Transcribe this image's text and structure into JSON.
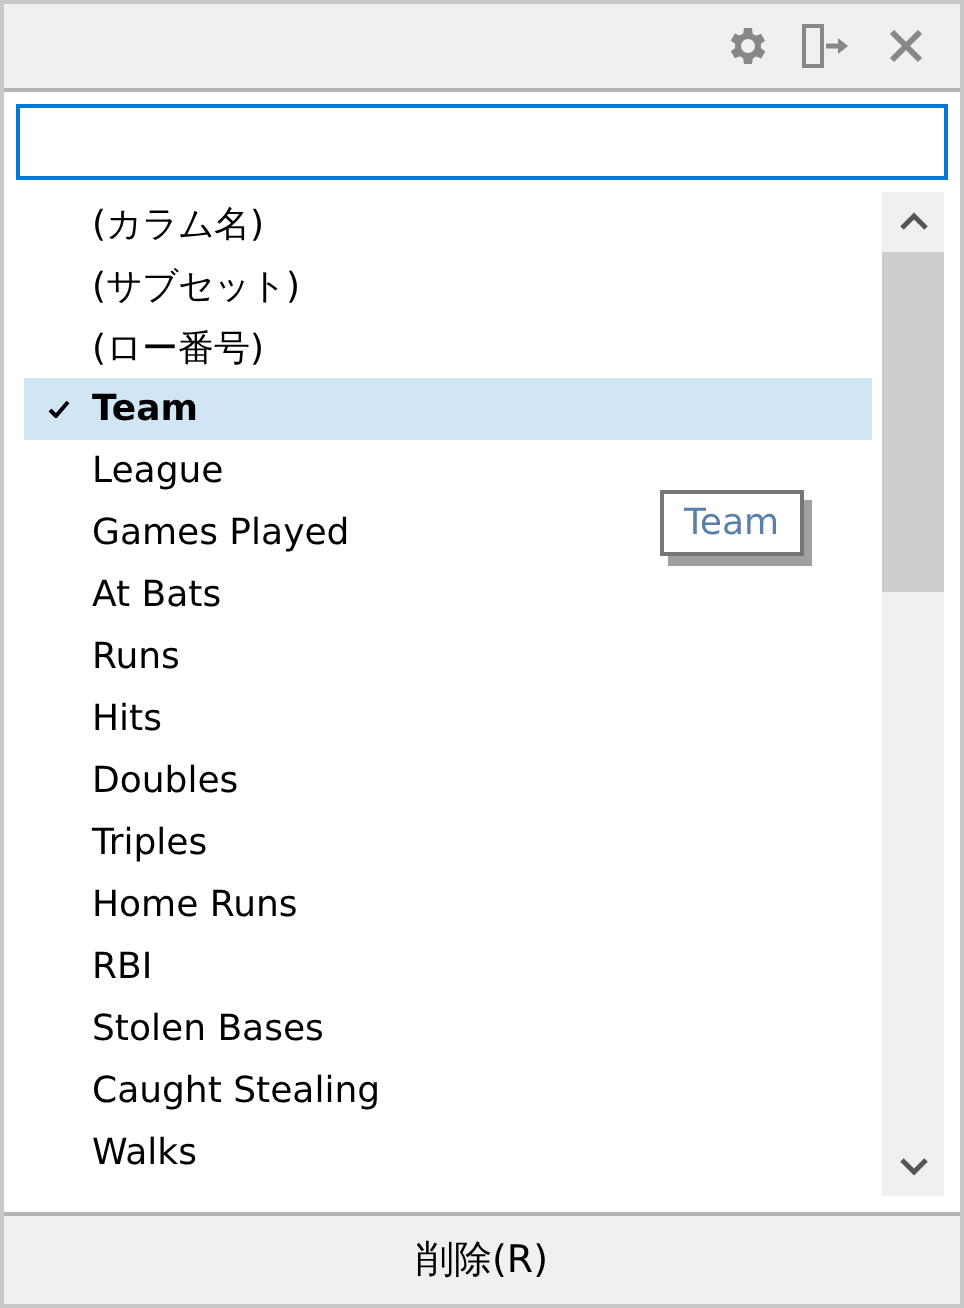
{
  "items": [
    {
      "label": "(カラム名)",
      "selected": false,
      "checked": false
    },
    {
      "label": "(サブセット)",
      "selected": false,
      "checked": false
    },
    {
      "label": "(ロー番号)",
      "selected": false,
      "checked": false
    },
    {
      "label": "Team",
      "selected": true,
      "checked": true
    },
    {
      "label": "League",
      "selected": false,
      "checked": false
    },
    {
      "label": "Games Played",
      "selected": false,
      "checked": false
    },
    {
      "label": "At Bats",
      "selected": false,
      "checked": false
    },
    {
      "label": "Runs",
      "selected": false,
      "checked": false
    },
    {
      "label": "Hits",
      "selected": false,
      "checked": false
    },
    {
      "label": "Doubles",
      "selected": false,
      "checked": false
    },
    {
      "label": "Triples",
      "selected": false,
      "checked": false
    },
    {
      "label": "Home Runs",
      "selected": false,
      "checked": false
    },
    {
      "label": "RBI",
      "selected": false,
      "checked": false
    },
    {
      "label": "Stolen Bases",
      "selected": false,
      "checked": false
    },
    {
      "label": "Caught Stealing",
      "selected": false,
      "checked": false
    },
    {
      "label": "Walks",
      "selected": false,
      "checked": false
    }
  ],
  "tooltip": {
    "text": "Team"
  },
  "delete_button": {
    "label": "削除(R)"
  }
}
